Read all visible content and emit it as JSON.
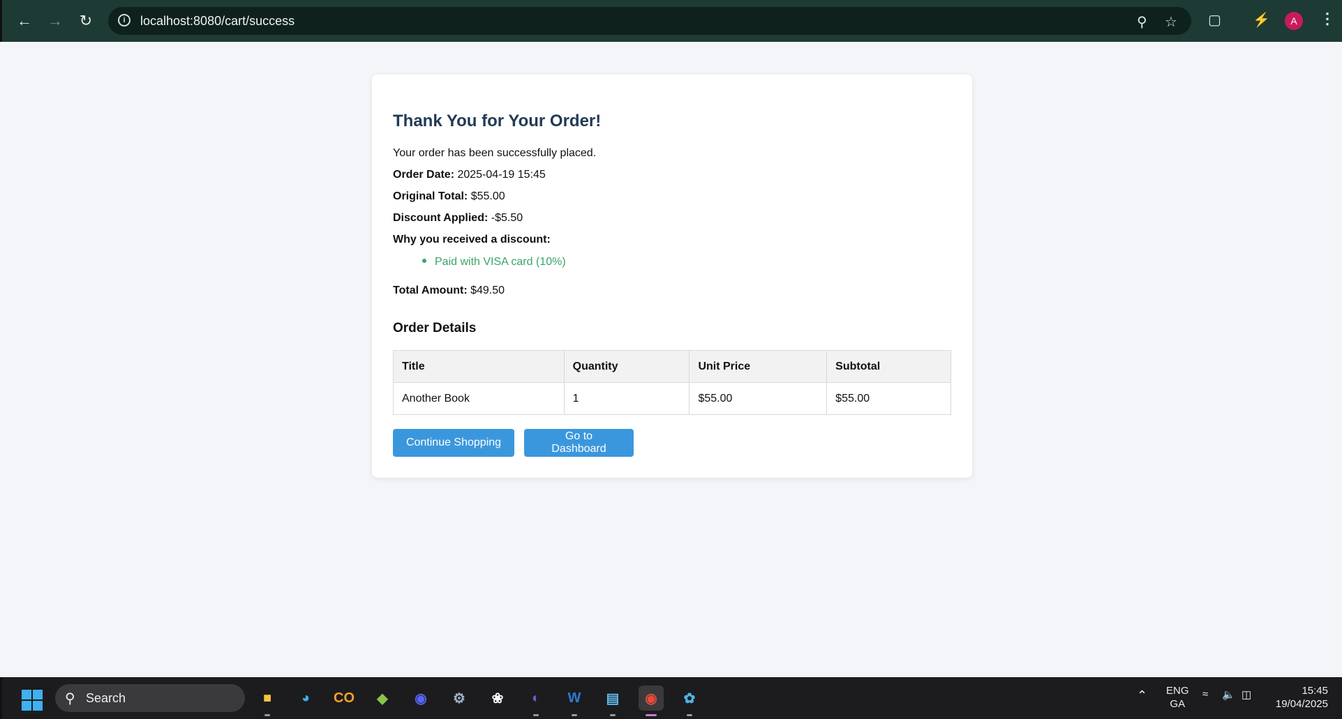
{
  "browser": {
    "url": "localhost:8080/cart/success",
    "profile_initial": "A"
  },
  "order": {
    "title": "Thank You for Your Order!",
    "message": "Your order has been successfully placed.",
    "order_date_label": "Order Date:",
    "order_date": "2025-04-19 15:45",
    "original_total_label": "Original Total:",
    "original_total": "$55.00",
    "discount_label": "Discount Applied:",
    "discount": "-$5.50",
    "discount_reason_label": "Why you received a discount:",
    "discount_reasons": [
      "Paid with VISA card (10%)"
    ],
    "total_label": "Total Amount:",
    "total": "$49.50",
    "details_title": "Order Details",
    "table": {
      "headers": [
        "Title",
        "Quantity",
        "Unit Price",
        "Subtotal"
      ],
      "rows": [
        [
          "Another Book",
          "1",
          "$55.00",
          "$55.00"
        ]
      ]
    },
    "buttons": {
      "continue": "Continue Shopping",
      "dashboard": "Go to Dashboard"
    }
  },
  "taskbar": {
    "search_label": "Search",
    "language": "ENG",
    "language_sub": "GA",
    "time": "15:45",
    "date": "19/04/2025"
  },
  "colors": {
    "accent_button": "#3b97dd",
    "discount_green": "#3aa468",
    "title_navy": "#223a55"
  }
}
